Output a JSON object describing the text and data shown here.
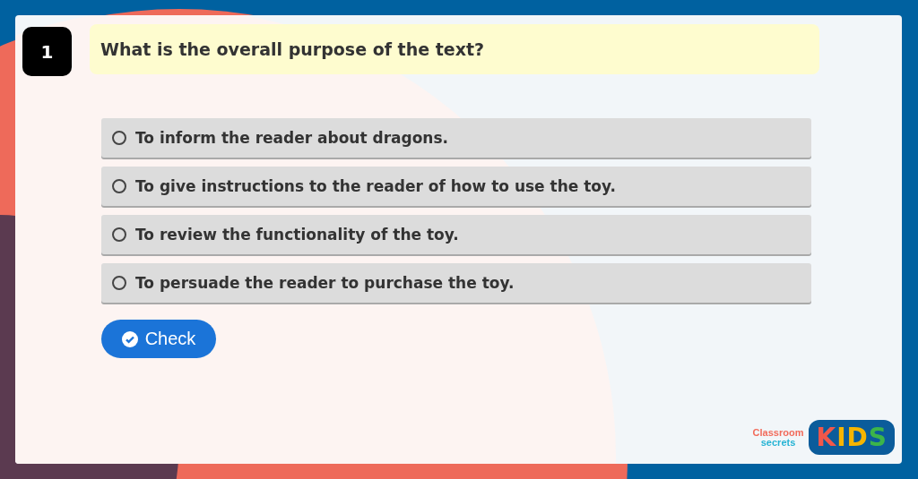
{
  "question": {
    "number": "1",
    "text": "What is the overall purpose of the text?"
  },
  "options": [
    {
      "label": "To inform the reader about dragons.",
      "selected": false
    },
    {
      "label": "To give instructions to the reader of how to use the toy.",
      "selected": false
    },
    {
      "label": "To review the functionality of the toy.",
      "selected": false
    },
    {
      "label": "To persuade the reader to purchase the toy.",
      "selected": false
    }
  ],
  "check_button": {
    "label": "Check"
  },
  "logo": {
    "brand_top": "Classroom",
    "brand_bottom": "secrets",
    "badge": "KIDS"
  }
}
